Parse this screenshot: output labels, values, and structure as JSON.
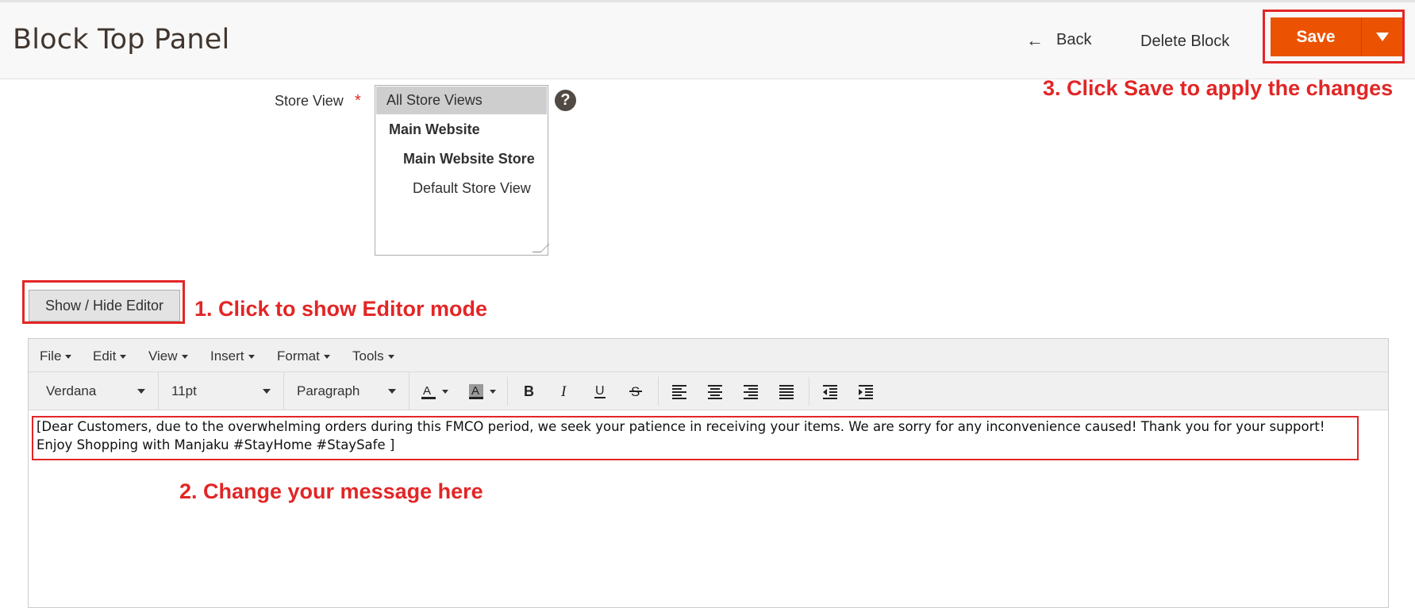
{
  "header": {
    "title": "Block Top Panel",
    "back_label": "Back",
    "delete_label": "Delete Block",
    "save_label": "Save"
  },
  "annotations": {
    "step1": "1. Click to show Editor mode",
    "step2": "2. Change your message here",
    "step3": "3. Click Save to apply the changes"
  },
  "store_view": {
    "label": "Store View",
    "required_mark": "*",
    "help_icon_text": "?",
    "options": [
      {
        "label": "All Store Views",
        "selected": true
      },
      {
        "label": "Main Website",
        "selected": false
      },
      {
        "label": "Main Website Store",
        "selected": false
      },
      {
        "label": "Default Store View",
        "selected": false
      }
    ]
  },
  "editor": {
    "toggle_label": "Show / Hide Editor",
    "menus": [
      "File",
      "Edit",
      "View",
      "Insert",
      "Format",
      "Tools"
    ],
    "font_family": "Verdana",
    "font_size": "11pt",
    "block_format": "Paragraph",
    "content": "[Dear Customers, due to the overwhelming orders during this FMCO period, we seek your patience in receiving your items. We are sorry for any inconvenience caused! Thank you for your support! Enjoy Shopping with Manjaku #StayHome #StaySafe ]"
  },
  "colors": {
    "accent": "#eb5202",
    "annotation_red": "#e22626",
    "title_color": "#41362f"
  }
}
